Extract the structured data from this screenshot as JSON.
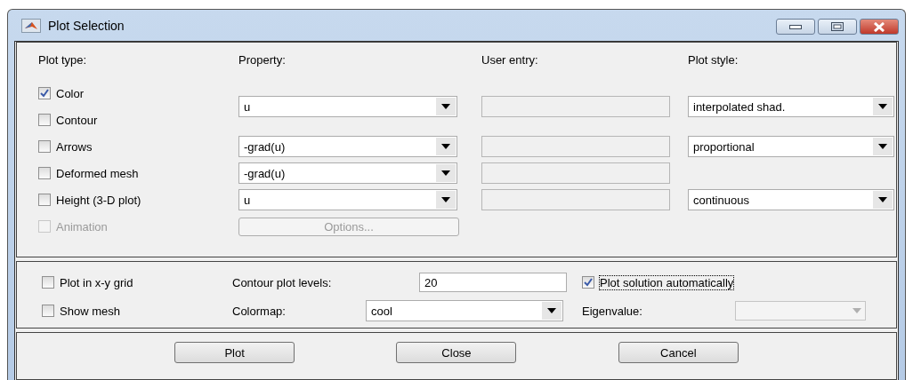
{
  "window": {
    "title": "Plot Selection"
  },
  "headers": [
    "Plot type:",
    "Property:",
    "User entry:",
    "Plot style:"
  ],
  "rows": [
    {
      "types": [
        {
          "label": "Color",
          "checked": true,
          "disabled": false
        },
        {
          "label": "Contour",
          "checked": false,
          "disabled": false
        }
      ],
      "property": {
        "kind": "dropdown",
        "value": "u"
      },
      "user_entry": {
        "disabled": true
      },
      "style": {
        "value": "interpolated shad."
      }
    },
    {
      "types": [
        {
          "label": "Arrows",
          "checked": false,
          "disabled": false
        }
      ],
      "property": {
        "kind": "dropdown",
        "value": "-grad(u)"
      },
      "user_entry": {
        "disabled": true
      },
      "style": {
        "value": "proportional"
      }
    },
    {
      "types": [
        {
          "label": "Deformed mesh",
          "checked": false,
          "disabled": false
        }
      ],
      "property": {
        "kind": "dropdown",
        "value": "-grad(u)"
      },
      "user_entry": {
        "disabled": true
      }
    },
    {
      "types": [
        {
          "label": "Height (3-D plot)",
          "checked": false,
          "disabled": false
        }
      ],
      "property": {
        "kind": "dropdown",
        "value": "u"
      },
      "user_entry": {
        "disabled": true
      },
      "style": {
        "value": "continuous"
      }
    },
    {
      "types": [
        {
          "label": "Animation",
          "checked": false,
          "disabled": true
        }
      ],
      "property": {
        "kind": "button",
        "value": "Options...",
        "disabled": true
      }
    }
  ],
  "options": {
    "plot_grid": {
      "label": "Plot in x-y grid",
      "checked": false
    },
    "show_mesh": {
      "label": "Show mesh",
      "checked": false
    },
    "levels_label": "Contour plot levels:",
    "levels": "20",
    "colormap_label": "Colormap:",
    "colormap": "cool",
    "auto": {
      "label": "Plot solution automatically",
      "checked": true
    },
    "eigen_label": "Eigenvalue:",
    "eigen": {
      "disabled": true
    }
  },
  "buttons": [
    "Plot",
    "Close",
    "Cancel"
  ]
}
